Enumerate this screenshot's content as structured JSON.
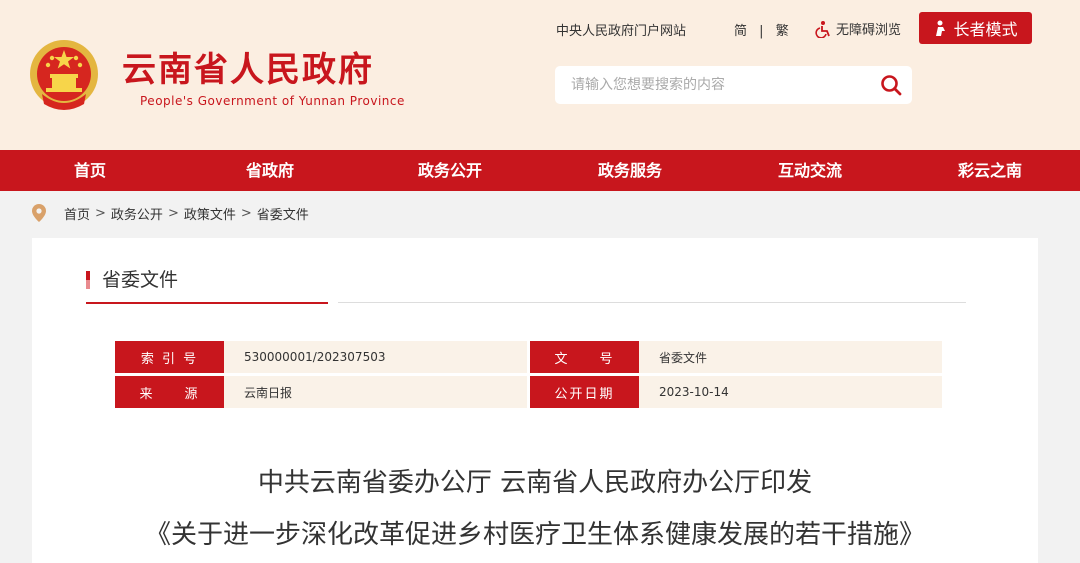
{
  "header": {
    "site_title": "云南省人民政府",
    "site_subtitle": "People's Government of Yunnan Province",
    "portal_link": "中央人民政府门户网站",
    "lang_simplified": "简",
    "lang_separator": "|",
    "lang_traditional": "繁",
    "accessibility": "无障碍浏览",
    "elder_mode": "长者模式",
    "search_placeholder": "请输入您想要搜索的内容"
  },
  "nav": {
    "items": [
      "首页",
      "省政府",
      "政务公开",
      "政务服务",
      "互动交流",
      "彩云之南"
    ]
  },
  "breadcrumb": {
    "items": [
      "首页",
      "政务公开",
      "政策文件",
      "省委文件"
    ],
    "separator": ">"
  },
  "section": {
    "title": "省委文件"
  },
  "meta": {
    "index_label": "索 引 号",
    "index_value": "530000001/202307503",
    "docno_label": "文　　号",
    "docno_value": "省委文件",
    "source_label": "来　　源",
    "source_value": "云南日报",
    "date_label": "公开日期",
    "date_value": "2023-10-14"
  },
  "document": {
    "title_line1": "中共云南省委办公厅 云南省人民政府办公厅印发",
    "title_line2": "《关于进一步深化改革促进乡村医疗卫生体系健康发展的若干措施》"
  },
  "colors": {
    "brand_red": "#c8161d",
    "header_bg": "#fbeee1",
    "meta_bg": "#faf2e8"
  }
}
